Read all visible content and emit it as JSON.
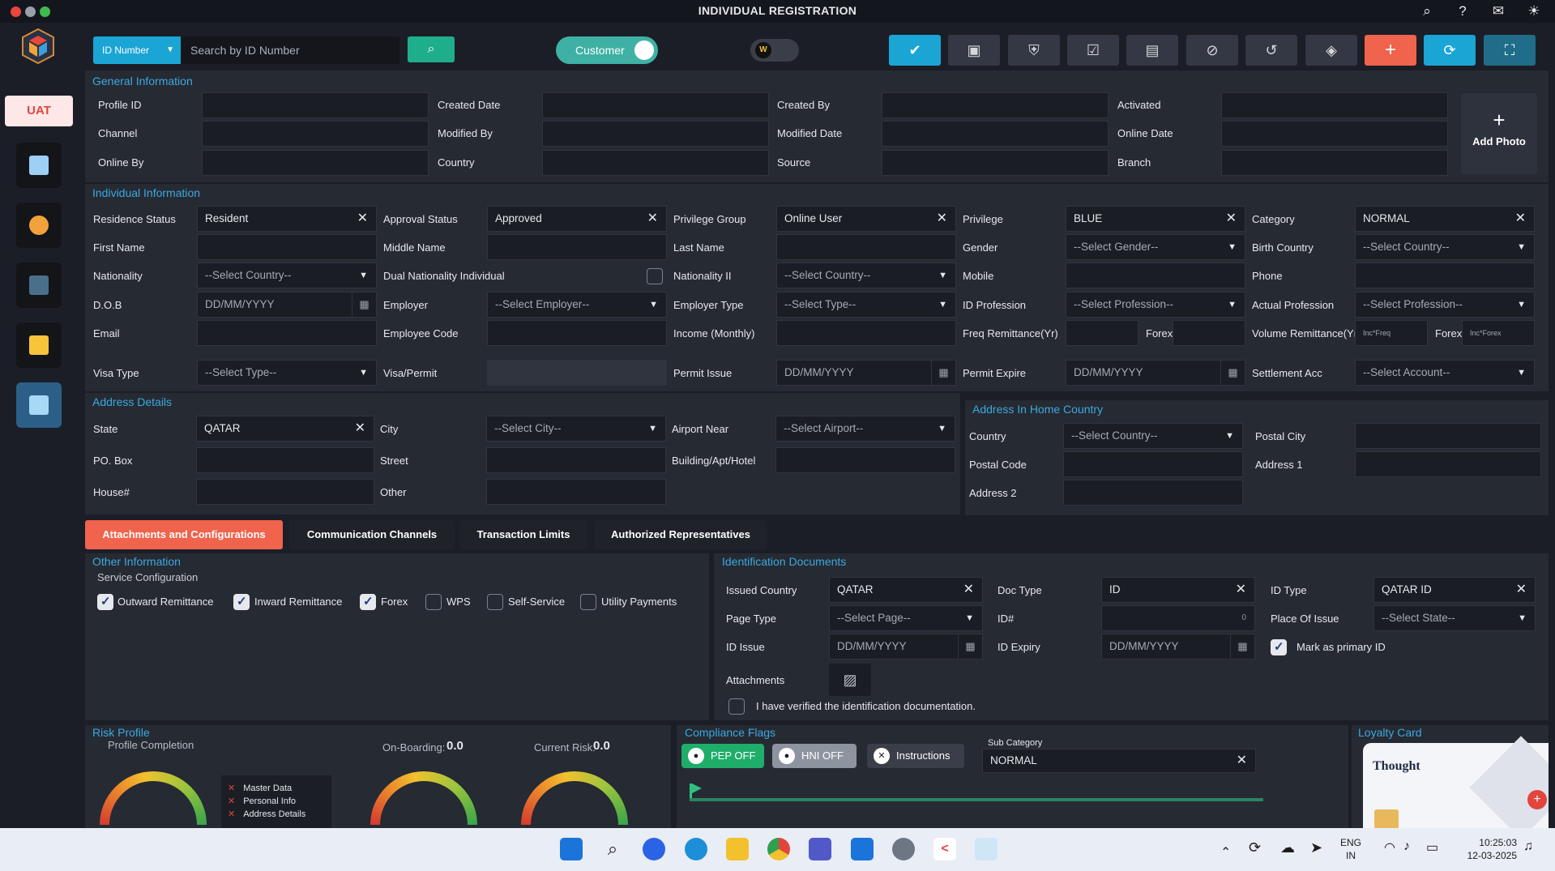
{
  "window": {
    "title": "INDIVIDUAL REGISTRATION"
  },
  "title_icons": [
    "search-icon",
    "help-icon",
    "chat-icon",
    "brightness-icon"
  ],
  "sidebar": {
    "env_badge": "UAT",
    "items": [
      "home-icon",
      "profile-icon",
      "terminal-icon",
      "folder-icon",
      "registration-icon"
    ]
  },
  "toolbar": {
    "id_type": "ID Number",
    "search_placeholder": "Search by ID Number",
    "customer_toggle": "Customer",
    "w_toggle": "W",
    "buttons": [
      "check-icon",
      "save-icon",
      "shield-check-icon",
      "checklist-icon",
      "clipboard-icon",
      "block-icon",
      "history-icon",
      "shield-icon",
      "plus-icon",
      "refresh-icon",
      "scan-icon"
    ],
    "colors": {
      "check": "#1aa5d5",
      "plus": "#f0634c",
      "refresh": "#1aa5d5",
      "scan": "#1f6d88"
    }
  },
  "general": {
    "title": "General Information",
    "fields": {
      "profile_id": "Profile ID",
      "created_date": "Created Date",
      "created_by": "Created By",
      "activated": "Activated",
      "channel": "Channel",
      "modified_by": "Modified By",
      "modified_date": "Modified Date",
      "online_date": "Online Date",
      "online_by": "Online By",
      "country": "Country",
      "source": "Source",
      "branch": "Branch"
    },
    "add_photo": "Add Photo"
  },
  "individual": {
    "title": "Individual Information",
    "labels": {
      "residence_status": "Residence Status",
      "approval_status": "Approval Status",
      "privilege_group": "Privilege Group",
      "privilege": "Privilege",
      "category": "Category",
      "first_name": "First Name",
      "middle_name": "Middle Name",
      "last_name": "Last Name",
      "gender": "Gender",
      "birth_country": "Birth Country",
      "nationality": "Nationality",
      "dual_nationality": "Dual Nationality Individual",
      "nationality2": "Nationality II",
      "mobile": "Mobile",
      "phone": "Phone",
      "dob": "D.O.B",
      "employer": "Employer",
      "employer_type": "Employer Type",
      "id_profession": "ID Profession",
      "actual_profession": "Actual Profession",
      "email": "Email",
      "employee_code": "Employee Code",
      "income": "Income (Monthly)",
      "freq_remittance": "Freq Remittance(Yr)",
      "forex": "Forex",
      "volume_remittance": "Volume Remittance(Yr",
      "visa_type": "Visa Type",
      "visa_permit": "Visa/Permit",
      "permit_issue": "Permit Issue",
      "permit_expire": "Permit Expire",
      "settlement_acc": "Settlement Acc"
    },
    "values": {
      "residence_status": "Resident",
      "approval_status": "Approved",
      "privilege_group": "Online User",
      "privilege": "BLUE",
      "category": "NORMAL",
      "gender": "--Select Gender--",
      "birth_country": "--Select Country--",
      "nationality": "--Select Country--",
      "nationality2": "--Select Country--",
      "dob": "DD/MM/YYYY",
      "employer": "--Select Employer--",
      "employer_type": "--Select Type--",
      "id_profession": "--Select Profession--",
      "actual_profession": "--Select Profession--",
      "volume_freq": "Inc*Freq",
      "volume_forex": "Inc*Forex",
      "visa_type": "--Select Type--",
      "permit_issue": "DD/MM/YYYY",
      "permit_expire": "DD/MM/YYYY",
      "settlement_acc": "--Select Account--"
    }
  },
  "address": {
    "title": "Address Details",
    "labels": {
      "state": "State",
      "city": "City",
      "airport": "Airport Near",
      "po_box": "PO. Box",
      "street": "Street",
      "building": "Building/Apt/Hotel",
      "house": "House#",
      "other": "Other"
    },
    "values": {
      "state": "QATAR",
      "city": "--Select City--",
      "airport": "--Select Airport--"
    }
  },
  "home_address": {
    "title": "Address In Home Country",
    "labels": {
      "country": "Country",
      "postal_city": "Postal City",
      "postal_code": "Postal Code",
      "address1": "Address 1",
      "address2": "Address 2"
    },
    "values": {
      "country": "--Select Country--"
    }
  },
  "tabs": [
    "Attachments and Configurations",
    "Communication Channels",
    "Transaction Limits",
    "Authorized Representatives"
  ],
  "other_info": {
    "title": "Other Information",
    "subtitle": "Service Configuration",
    "services": [
      {
        "label": "Outward Remittance",
        "checked": true
      },
      {
        "label": "Inward Remittance",
        "checked": true
      },
      {
        "label": "Forex",
        "checked": true
      },
      {
        "label": "WPS",
        "checked": false
      },
      {
        "label": "Self-Service",
        "checked": false
      },
      {
        "label": "Utility Payments",
        "checked": false
      }
    ]
  },
  "id_docs": {
    "title": "Identification Documents",
    "labels": {
      "issued_country": "Issued Country",
      "doc_type": "Doc Type",
      "id_type": "ID Type",
      "page_type": "Page Type",
      "id_no": "ID#",
      "place_of_issue": "Place Of Issue",
      "id_issue": "ID Issue",
      "id_expiry": "ID Expiry",
      "primary": "Mark as primary ID",
      "attachments": "Attachments",
      "verified": "I have verified the identification documentation."
    },
    "values": {
      "issued_country": "QATAR",
      "doc_type": "ID",
      "id_type": "QATAR ID",
      "page_type": "--Select Page--",
      "id_counter": "0",
      "place_of_issue": "--Select State--",
      "id_issue": "DD/MM/YYYY",
      "id_expiry": "DD/MM/YYYY"
    },
    "primary_checked": true,
    "verified_checked": false
  },
  "risk": {
    "title": "Risk Profile",
    "profile_completion": "Profile Completion",
    "onboarding_label": "On-Boarding:",
    "onboarding_value": "0.0",
    "current_label": "Current Risk:",
    "current_value": "0.0",
    "checklist": [
      "Master Data",
      "Personal Info",
      "Address Details"
    ]
  },
  "compliance": {
    "title": "Compliance Flags",
    "pep": "PEP OFF",
    "hni": "HNI OFF",
    "instructions": "Instructions",
    "sub_category_label": "Sub Category",
    "sub_category_value": "NORMAL"
  },
  "loyalty": {
    "title": "Loyalty Card",
    "brand": "Thought"
  },
  "taskbar": {
    "apps": [
      "windows-start-icon",
      "search-icon",
      "app-store-icon",
      "edge-icon",
      "file-explorer-icon",
      "chrome-icon",
      "teams-icon",
      "notepad-icon",
      "settings-icon",
      "app-icon",
      "snipping-icon"
    ],
    "lang_top": "ENG",
    "lang_bottom": "IN",
    "time": "10:25:03",
    "date": "12-03-2025"
  }
}
